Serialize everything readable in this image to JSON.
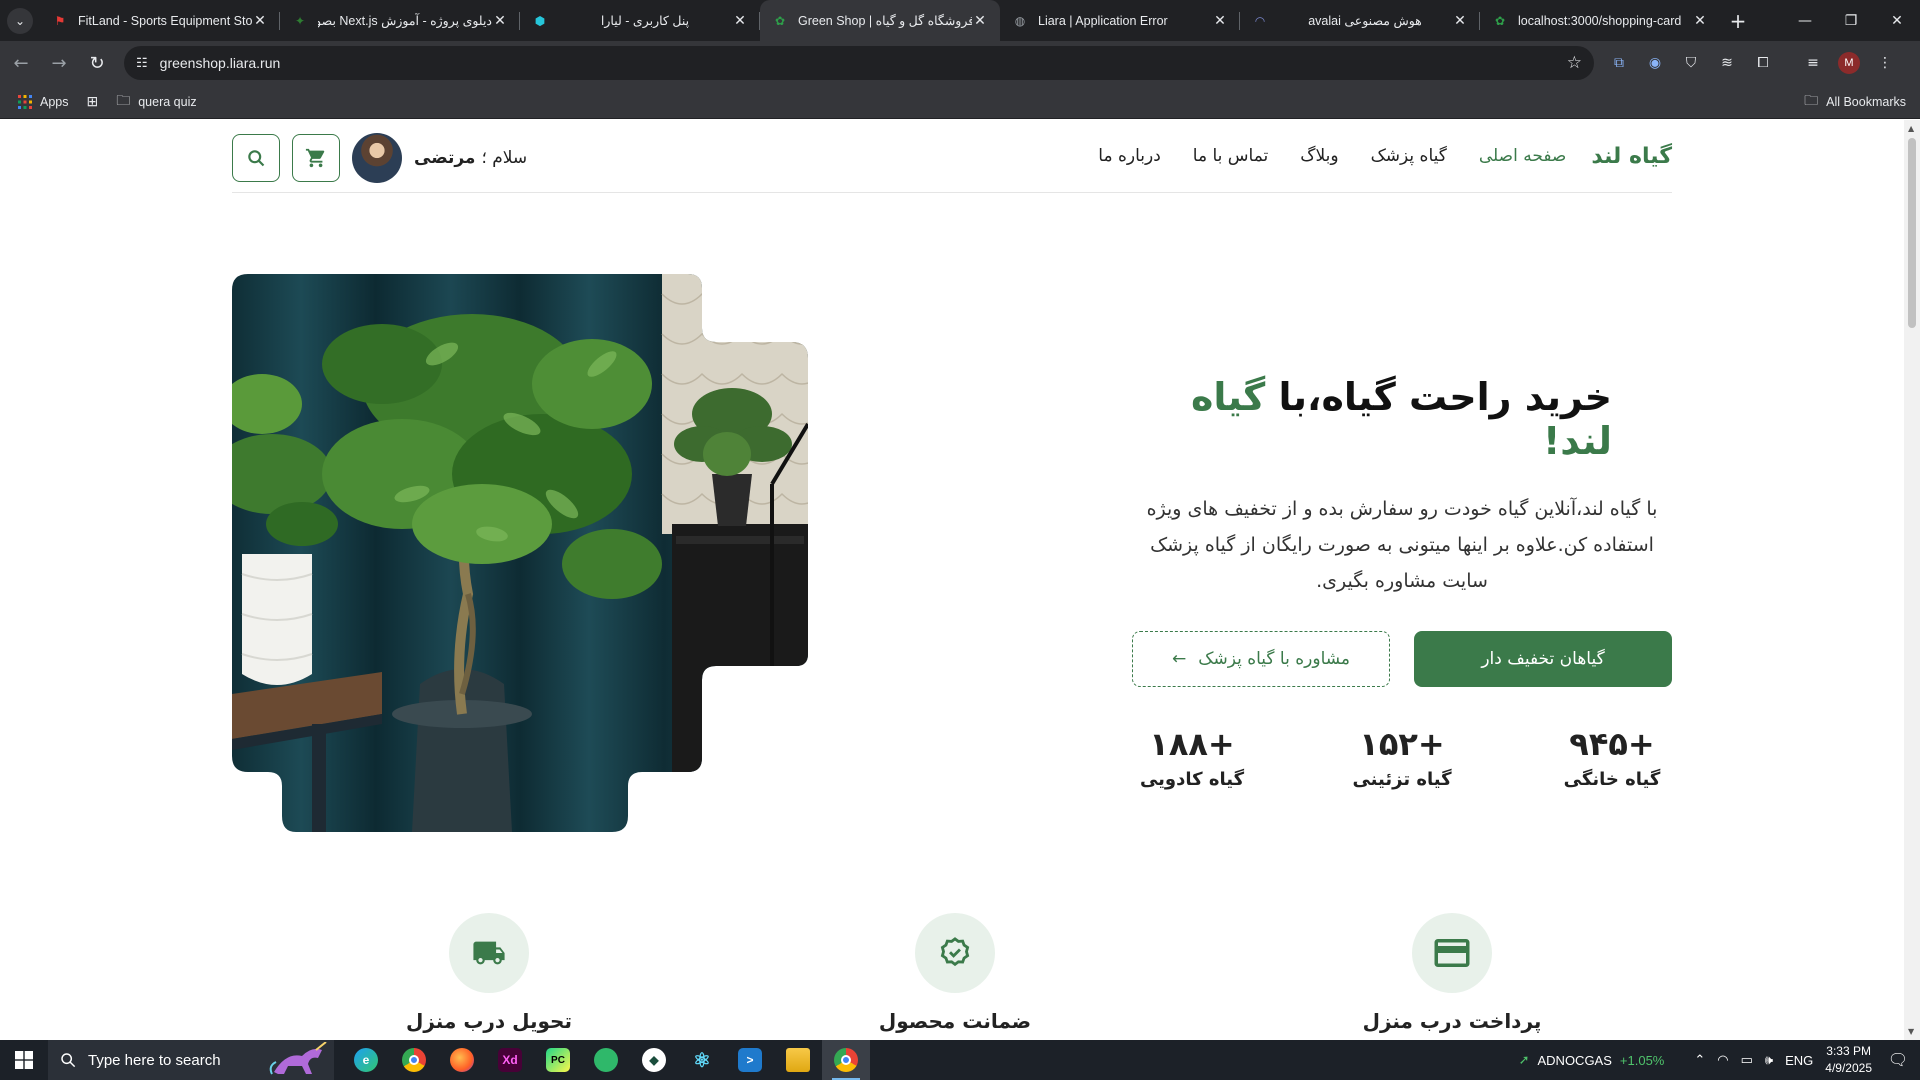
{
  "browser": {
    "tabs": [
      {
        "title": "FitLand - Sports Equipment Sto",
        "fav_color": "#e53935",
        "active": false
      },
      {
        "title": "دیلوی پروژه - آموزش Next.js بصو",
        "fav_color": "#2e7d32",
        "active": false
      },
      {
        "title": "پنل کاربری - لیارا",
        "fav_color": "#26c6da",
        "active": false
      },
      {
        "title": "Green Shop | فروشگاه گل و گیاه",
        "fav_color": "#2e7d32",
        "active": true
      },
      {
        "title": "Liara | Application Error",
        "fav_color": "#9aa0a6",
        "active": false
      },
      {
        "title": "هوش مصنوعی avalai",
        "fav_color": "#5c6bc0",
        "active": false
      },
      {
        "title": "localhost:3000/shopping-card",
        "fav_color": "#2e7d32",
        "active": false
      }
    ],
    "url": "greenshop.liara.run",
    "bookmarks": {
      "apps": "Apps",
      "folder": "quera quiz",
      "all": "All Bookmarks"
    },
    "profile_initial": "M"
  },
  "site": {
    "logo": "گیاه لند",
    "nav": [
      {
        "label": "صفحه اصلی",
        "active": true
      },
      {
        "label": "گیاه پزشک",
        "active": false
      },
      {
        "label": "وبلاگ",
        "active": false
      },
      {
        "label": "تماس با ما",
        "active": false
      },
      {
        "label": "درباره ما",
        "active": false
      }
    ],
    "greeting_prefix": "سلام ؛",
    "user_name": "مرتضی",
    "hero": {
      "title_main": "خرید راحت گیاه،با",
      "title_brand": "گیاه لند!",
      "description": "با گیاه لند،آنلاین گیاه خودت رو سفارش بده و از تخفیف های ویژه استفاده کن.علاوه بر اینها میتونی به صورت رایگان از گیاه پزشک سایت مشاوره بگیری.",
      "btn_primary": "گیاهان تخفیف دار",
      "btn_secondary": "مشاوره با گیاه پزشک"
    },
    "stats": [
      {
        "value": "+۹۴۵",
        "label": "گیاه خانگی"
      },
      {
        "value": "+۱۵۲",
        "label": "گیاه تزئینی"
      },
      {
        "value": "+۱۸۸",
        "label": "گیاه کادویی"
      }
    ],
    "features": [
      {
        "title": "پرداخت درب منزل",
        "icon": "credit-card-icon"
      },
      {
        "title": "ضمانت محصول",
        "icon": "verified-badge-icon"
      },
      {
        "title": "تحویل درب منزل",
        "icon": "truck-icon"
      }
    ],
    "accent_color": "#3b7a4a"
  },
  "taskbar": {
    "search_placeholder": "Type here to search",
    "stock_name": "ADNOCGAS",
    "stock_change": "+1.05%",
    "language": "ENG",
    "time": "3:33 PM",
    "date": "4/9/2025"
  }
}
